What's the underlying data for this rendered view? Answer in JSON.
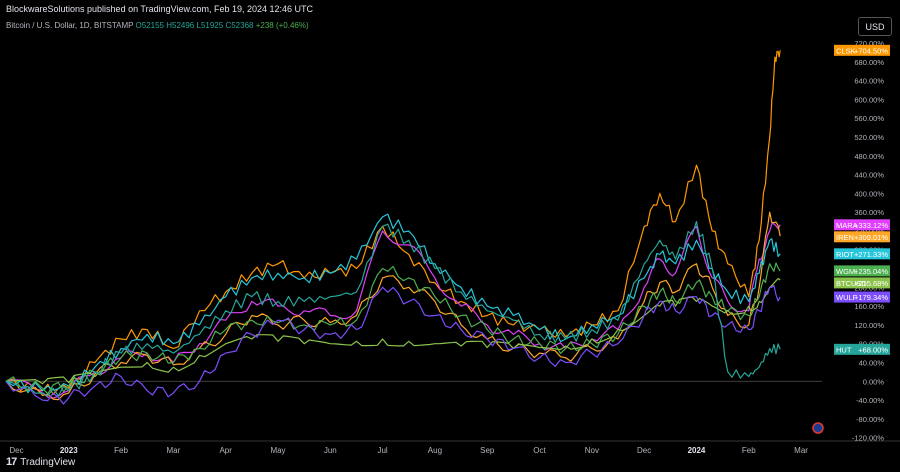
{
  "header": {
    "publisher_line": "BlockwareSolutions published on TradingView.com, Feb 19, 2024 12:46 UTC",
    "currency_button": "USD"
  },
  "symbol_bar": {
    "name": "Bitcoin / U.S. Dollar, 1D, BITSTAMP",
    "open": "O52155",
    "high": "H52496",
    "low": "L51925",
    "close": "C52368",
    "change": "+238 (+0.46%)"
  },
  "footer": {
    "logo_text": "TradingView"
  },
  "chart_data": {
    "type": "line",
    "y_unit": "%",
    "ylim": [
      -125,
      735
    ],
    "y_ticks": [
      "720.00%",
      "680.00%",
      "640.00%",
      "600.00%",
      "560.00%",
      "520.00%",
      "480.00%",
      "440.00%",
      "400.00%",
      "360.00%",
      "320.00%",
      "280.00%",
      "240.00%",
      "200.00%",
      "160.00%",
      "120.00%",
      "80.00%",
      "40.00%",
      "0.00%",
      "-40.00%",
      "-80.00%",
      "-120.00%"
    ],
    "x_ticks": [
      {
        "label": "Dec",
        "x": 0.0,
        "bold": false
      },
      {
        "label": "2023",
        "x": 1.0,
        "bold": true
      },
      {
        "label": "Feb",
        "x": 2.0,
        "bold": false
      },
      {
        "label": "Mar",
        "x": 3.0,
        "bold": false
      },
      {
        "label": "Apr",
        "x": 4.0,
        "bold": false
      },
      {
        "label": "May",
        "x": 5.0,
        "bold": false
      },
      {
        "label": "Jun",
        "x": 6.0,
        "bold": false
      },
      {
        "label": "Jul",
        "x": 7.0,
        "bold": false
      },
      {
        "label": "Aug",
        "x": 8.0,
        "bold": false
      },
      {
        "label": "Sep",
        "x": 9.0,
        "bold": false
      },
      {
        "label": "Oct",
        "x": 10.0,
        "bold": false
      },
      {
        "label": "Nov",
        "x": 11.0,
        "bold": false
      },
      {
        "label": "Dec",
        "x": 12.0,
        "bold": false
      },
      {
        "label": "2024",
        "x": 13.0,
        "bold": true
      },
      {
        "label": "Feb",
        "x": 14.0,
        "bold": false
      },
      {
        "label": "Mar",
        "x": 15.0,
        "bold": false
      }
    ],
    "xlim": [
      -0.2,
      15.4
    ],
    "grid": false,
    "series": [
      {
        "name": "CLSK",
        "color": "#ff9800",
        "tag": "+704.50%",
        "x": [
          -0.2,
          0.5,
          1.0,
          1.5,
          2.0,
          2.5,
          3.0,
          3.5,
          4.0,
          4.5,
          5.0,
          5.5,
          6.0,
          6.5,
          7.0,
          7.5,
          8.0,
          8.5,
          9.0,
          9.5,
          10.0,
          10.5,
          11.0,
          11.5,
          12.0,
          12.3,
          12.6,
          13.0,
          13.3,
          13.6,
          14.0,
          14.2,
          14.4,
          14.5,
          14.6
        ],
        "y": [
          0,
          -20,
          -15,
          40,
          90,
          110,
          70,
          150,
          190,
          230,
          250,
          220,
          230,
          240,
          330,
          270,
          210,
          170,
          140,
          120,
          110,
          95,
          120,
          150,
          330,
          400,
          340,
          460,
          320,
          250,
          180,
          300,
          520,
          690,
          704.5
        ]
      },
      {
        "name": "MARA",
        "color": "#e040fb",
        "tag": "+333.12%",
        "x": [
          -0.2,
          0.5,
          1.0,
          1.5,
          2.0,
          2.5,
          3.0,
          3.5,
          4.0,
          4.5,
          5.0,
          5.5,
          6.0,
          6.5,
          7.0,
          7.5,
          8.0,
          8.5,
          9.0,
          9.5,
          10.0,
          10.5,
          11.0,
          11.5,
          12.0,
          12.3,
          12.6,
          13.0,
          13.3,
          13.6,
          14.0,
          14.2,
          14.4,
          14.6
        ],
        "y": [
          0,
          -25,
          -20,
          20,
          50,
          60,
          40,
          80,
          130,
          170,
          160,
          150,
          140,
          150,
          320,
          290,
          220,
          160,
          120,
          100,
          80,
          70,
          90,
          110,
          200,
          260,
          230,
          330,
          220,
          170,
          150,
          260,
          320,
          333.1
        ]
      },
      {
        "name": "IREN",
        "color": "#ffa726",
        "tag": "+309.01%",
        "x": [
          -0.2,
          0.5,
          1.0,
          1.5,
          2.0,
          2.5,
          3.0,
          3.5,
          4.0,
          4.5,
          5.0,
          5.5,
          6.0,
          6.5,
          7.0,
          7.5,
          8.0,
          8.5,
          9.0,
          9.5,
          10.0,
          10.5,
          11.0,
          11.5,
          12.0,
          12.3,
          12.6,
          13.0,
          13.3,
          13.6,
          14.0,
          14.2,
          14.4,
          14.6
        ],
        "y": [
          0,
          -30,
          -25,
          15,
          40,
          55,
          35,
          70,
          100,
          140,
          120,
          130,
          125,
          140,
          220,
          200,
          170,
          120,
          90,
          70,
          60,
          50,
          70,
          90,
          170,
          210,
          190,
          250,
          200,
          140,
          120,
          200,
          360,
          309
        ]
      },
      {
        "name": "RIOT",
        "color": "#26c6da",
        "tag": "+271.33%",
        "x": [
          -0.2,
          0.5,
          1.0,
          1.5,
          2.0,
          2.5,
          3.0,
          3.5,
          4.0,
          4.5,
          5.0,
          5.5,
          6.0,
          6.5,
          7.0,
          7.5,
          8.0,
          8.5,
          9.0,
          9.5,
          10.0,
          10.5,
          11.0,
          11.5,
          12.0,
          12.3,
          12.6,
          13.0,
          13.3,
          13.6,
          14.0,
          14.2,
          14.4,
          14.6
        ],
        "y": [
          0,
          -20,
          -10,
          30,
          70,
          100,
          80,
          120,
          180,
          220,
          230,
          220,
          230,
          260,
          350,
          320,
          250,
          200,
          160,
          140,
          110,
          90,
          120,
          140,
          220,
          270,
          250,
          300,
          240,
          190,
          170,
          230,
          300,
          271.3
        ]
      },
      {
        "name": "WGMI",
        "color": "#4caf50",
        "tag": "+235.04%",
        "x": [
          -0.2,
          0.5,
          1.0,
          1.5,
          2.0,
          2.5,
          3.0,
          3.5,
          4.0,
          4.5,
          5.0,
          5.5,
          6.0,
          6.5,
          7.0,
          7.5,
          8.0,
          8.5,
          9.0,
          9.5,
          10.0,
          10.5,
          11.0,
          11.5,
          12.0,
          12.3,
          12.6,
          13.0,
          13.3,
          13.6,
          14.0,
          14.2,
          14.4,
          14.6
        ],
        "y": [
          0,
          -15,
          -10,
          20,
          50,
          60,
          40,
          70,
          110,
          130,
          125,
          120,
          120,
          130,
          240,
          220,
          180,
          140,
          110,
          90,
          80,
          70,
          80,
          100,
          160,
          190,
          170,
          210,
          180,
          150,
          140,
          180,
          250,
          235
        ]
      },
      {
        "name": "BTCUSD",
        "color": "#8bc34a",
        "tag": "+215.68%",
        "x": [
          -0.2,
          0.5,
          1.0,
          1.5,
          2.0,
          2.5,
          3.0,
          3.5,
          4.0,
          4.5,
          5.0,
          5.5,
          6.0,
          6.5,
          7.0,
          7.5,
          8.0,
          8.5,
          9.0,
          9.5,
          10.0,
          10.5,
          11.0,
          11.5,
          12.0,
          12.3,
          12.6,
          13.0,
          13.3,
          13.6,
          14.0,
          14.2,
          14.4,
          14.6
        ],
        "y": [
          0,
          -5,
          -3,
          10,
          30,
          40,
          30,
          55,
          80,
          90,
          85,
          80,
          80,
          85,
          90,
          85,
          80,
          75,
          72,
          70,
          72,
          75,
          90,
          110,
          140,
          160,
          160,
          170,
          160,
          150,
          160,
          170,
          200,
          215.7
        ]
      },
      {
        "name": "WULF",
        "color": "#7c4dff",
        "tag": "+179.34%",
        "x": [
          -0.2,
          0.5,
          1.0,
          1.5,
          2.0,
          2.5,
          3.0,
          3.5,
          4.0,
          4.5,
          5.0,
          5.5,
          6.0,
          6.5,
          7.0,
          7.5,
          8.0,
          8.5,
          9.0,
          9.5,
          10.0,
          10.5,
          11.0,
          11.5,
          12.0,
          12.3,
          12.6,
          13.0,
          13.3,
          13.6,
          14.0,
          14.2,
          14.4,
          14.6
        ],
        "y": [
          0,
          -40,
          -35,
          -10,
          10,
          -20,
          -25,
          0,
          60,
          100,
          130,
          110,
          100,
          110,
          200,
          170,
          140,
          110,
          90,
          70,
          50,
          40,
          60,
          80,
          140,
          170,
          150,
          180,
          140,
          120,
          110,
          150,
          200,
          179.3
        ]
      },
      {
        "name": "HUT",
        "color": "#26a69a",
        "tag": "+68.00%",
        "x": [
          -0.2,
          0.5,
          1.0,
          1.5,
          2.0,
          2.5,
          3.0,
          3.5,
          4.0,
          4.5,
          5.0,
          5.5,
          6.0,
          6.5,
          7.0,
          7.5,
          8.0,
          8.5,
          9.0,
          9.5,
          10.0,
          10.5,
          11.0,
          11.5,
          12.0,
          12.3,
          12.6,
          13.0,
          13.3,
          13.6,
          14.0,
          14.2,
          14.4,
          14.6
        ],
        "y": [
          0,
          -25,
          -20,
          20,
          60,
          80,
          60,
          100,
          150,
          180,
          170,
          170,
          180,
          190,
          330,
          300,
          240,
          190,
          150,
          130,
          100,
          90,
          110,
          130,
          250,
          300,
          260,
          340,
          240,
          20,
          10,
          30,
          70,
          68
        ]
      }
    ]
  }
}
